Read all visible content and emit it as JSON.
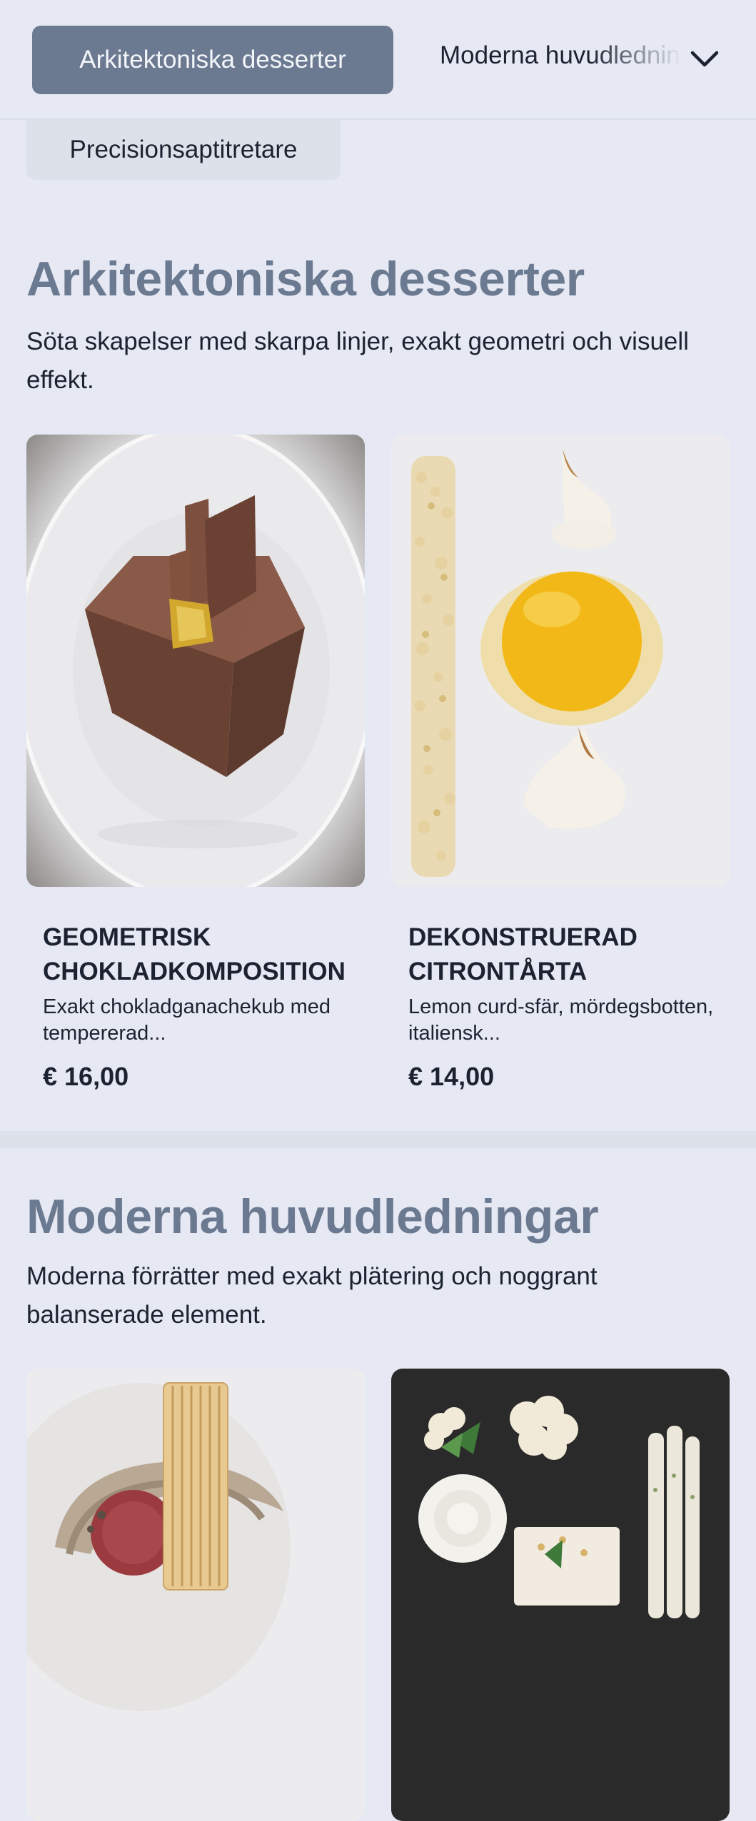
{
  "nav": {
    "active_tab": "Arkitektoniska desserter",
    "next_tab": "Moderna huvudledningar",
    "sub_tab": "Precisionsaptitretare",
    "dropdown_icon": "chevron-down-icon"
  },
  "sections": [
    {
      "title": "Arkitektoniska desserter",
      "description": "Söta skapelser med skarpa linjer, exakt geometri och visuell effekt.",
      "items": [
        {
          "title": "GEOMETRISK CHOKLADKOMPOSITION",
          "description": "Exakt chokladganachekub med tempererad...",
          "price": "€ 16,00"
        },
        {
          "title": "DEKONSTRUERAD CITRONTÅRTA",
          "description": "Lemon curd-sfär, mördegsbotten, italiensk...",
          "price": "€ 14,00"
        }
      ]
    },
    {
      "title": "Moderna huvudledningar",
      "description": "Moderna förrätter med exakt plätering och noggrant balanserade element."
    }
  ],
  "colors": {
    "accent": "#6b7a90",
    "background": "#e6e9f4",
    "text": "#1c2230"
  }
}
